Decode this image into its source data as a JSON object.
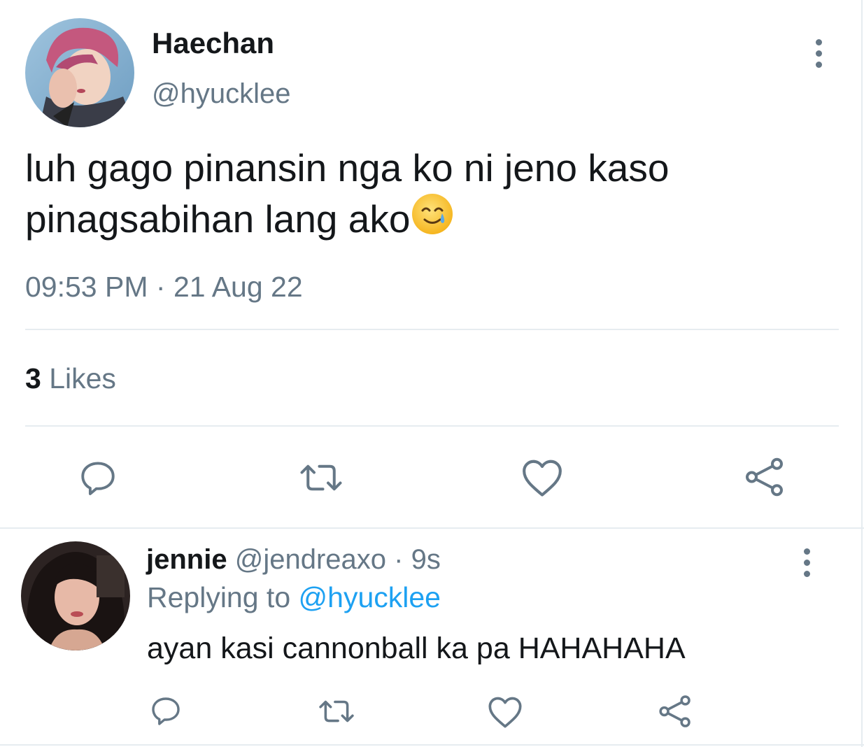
{
  "tweet": {
    "author_name": "Haechan",
    "author_handle": "@hyucklee",
    "text": "luh gago pinansin nga ko ni jeno kaso pinagsabihan lang ako",
    "emoji": "smiling-face-with-tear",
    "time": "09:53 PM",
    "separator": "·",
    "date": "21 Aug 22",
    "likes_count": "3",
    "likes_label": "Likes"
  },
  "reply": {
    "author_name": "jennie",
    "author_handle": "@jendreaxo",
    "separator": "·",
    "age": "9s",
    "replying_to_label": "Replying to",
    "replying_to_handle": "@hyucklee",
    "text": "ayan kasi cannonball ka pa HAHAHAHA"
  },
  "icons": {
    "reply": "comment-bubble-icon",
    "retweet": "retweet-icon",
    "like": "heart-icon",
    "share": "share-icon",
    "more": "vertical-dots-icon"
  },
  "colors": {
    "text_primary": "#14171a",
    "text_secondary": "#657786",
    "link": "#1da1f2",
    "divider": "#e6ecf0"
  }
}
